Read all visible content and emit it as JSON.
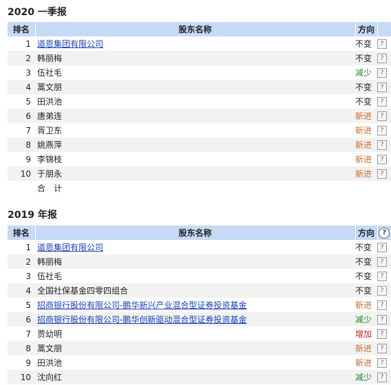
{
  "sections": [
    {
      "title": "2020 一季报",
      "headers": {
        "rank": "排名",
        "name": "股东名称",
        "direction": "方向",
        "help": "?"
      },
      "rows": [
        {
          "rank": "1",
          "name": "道恩集团有限公司",
          "direction": "不变",
          "help": "?"
        },
        {
          "rank": "2",
          "name": "韩丽梅",
          "direction": "不变",
          "help": "?"
        },
        {
          "rank": "3",
          "name": "伍社毛",
          "direction": "减少",
          "help": "?"
        },
        {
          "rank": "4",
          "name": "蒿文朋",
          "direction": "不变",
          "help": "?"
        },
        {
          "rank": "5",
          "name": "田洪池",
          "direction": "不变",
          "help": "?"
        },
        {
          "rank": "6",
          "name": "唐弟连",
          "direction": "新进",
          "help": "?"
        },
        {
          "rank": "7",
          "name": "胥卫东",
          "direction": "新进",
          "help": "?"
        },
        {
          "rank": "8",
          "name": "姚燕萍",
          "direction": "新进",
          "help": "?"
        },
        {
          "rank": "9",
          "name": "李锦枝",
          "direction": "新进",
          "help": "?"
        },
        {
          "rank": "10",
          "name": "于朋永",
          "direction": "新进",
          "help": "?"
        }
      ],
      "total_label": "合计"
    },
    {
      "title": "2019 年报",
      "headers": {
        "rank": "排名",
        "name": "股东名称",
        "direction": "方向",
        "help": "?"
      },
      "rows": [
        {
          "rank": "1",
          "name": "道恩集团有限公司",
          "direction": "不变",
          "help": "?"
        },
        {
          "rank": "2",
          "name": "韩丽梅",
          "direction": "不变",
          "help": "?"
        },
        {
          "rank": "3",
          "name": "伍社毛",
          "direction": "不变",
          "help": "?"
        },
        {
          "rank": "4",
          "name": "全国社保基金四零四组合",
          "direction": "不变",
          "help": "?"
        },
        {
          "rank": "5",
          "name": "招商银行股份有限公司-鹏华新兴产业混合型证券投资基金",
          "direction": "新进",
          "help": "?"
        },
        {
          "rank": "6",
          "name": "招商银行股份有限公司-鹏华创新驱动混合型证券投资基金",
          "direction": "减少",
          "help": "?"
        },
        {
          "rank": "7",
          "name": "贾幼明",
          "direction": "增加",
          "help": "?"
        },
        {
          "rank": "8",
          "name": "蒿文朋",
          "direction": "新进",
          "help": "?"
        },
        {
          "rank": "9",
          "name": "田洪池",
          "direction": "新进",
          "help": "?"
        },
        {
          "rank": "10",
          "name": "沈向红",
          "direction": "减少",
          "help": "?"
        }
      ]
    }
  ],
  "colors": {
    "header_bg": "#c6daf5",
    "link": "#1a3fbd",
    "new": "#d26a2a",
    "decrease": "#1e8a2a",
    "increase": "#c81e1e"
  }
}
